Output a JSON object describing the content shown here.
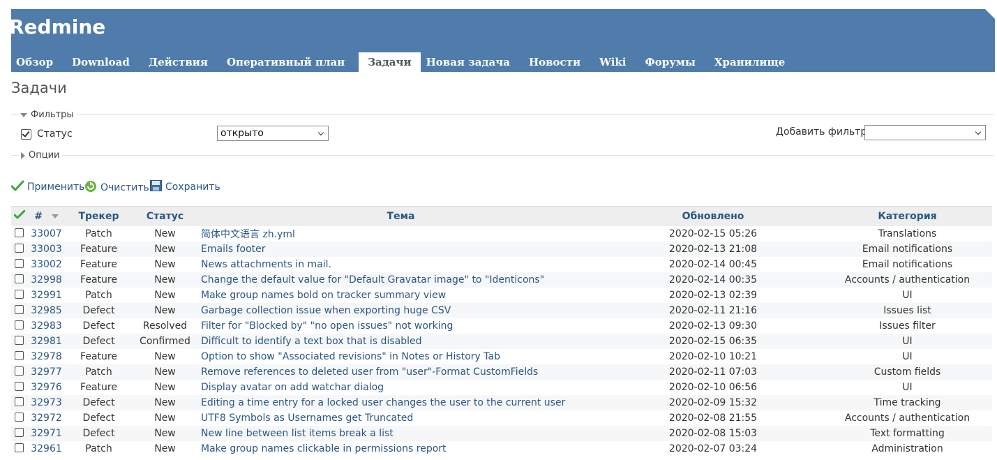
{
  "header": {
    "app_title": "Redmine",
    "menu": [
      {
        "label": "Обзор",
        "selected": false
      },
      {
        "label": "Download",
        "selected": false
      },
      {
        "label": "Действия",
        "selected": false
      },
      {
        "label": "Оперативный план",
        "selected": false
      },
      {
        "label": "Задачи",
        "selected": true
      },
      {
        "label": "Новая задача",
        "selected": false
      },
      {
        "label": "Новости",
        "selected": false
      },
      {
        "label": "Wiki",
        "selected": false
      },
      {
        "label": "Форумы",
        "selected": false
      },
      {
        "label": "Хранилище",
        "selected": false
      }
    ]
  },
  "page_title": "Задачи",
  "filters": {
    "legend": "Фильтры",
    "status_label": "Статус",
    "status_checked": true,
    "status_operator": "открыто",
    "add_filter_label": "Добавить фильтр",
    "add_filter_value": ""
  },
  "options": {
    "legend": "Опции"
  },
  "actions": {
    "apply": "Применить",
    "clear": "Очистить",
    "save": "Сохранить"
  },
  "table": {
    "headers": {
      "id": "#",
      "tracker": "Трекер",
      "status": "Статус",
      "subject": "Тема",
      "updated": "Обновлено",
      "category": "Категория"
    },
    "rows": [
      {
        "id": "33007",
        "tracker": "Patch",
        "status": "New",
        "subject": "简体中文语言 zh.yml",
        "updated": "2020-02-15 05:26",
        "category": "Translations"
      },
      {
        "id": "33003",
        "tracker": "Feature",
        "status": "New",
        "subject": "Emails footer",
        "updated": "2020-02-13 21:08",
        "category": "Email notifications"
      },
      {
        "id": "33002",
        "tracker": "Feature",
        "status": "New",
        "subject": "News attachments in mail.",
        "updated": "2020-02-14 00:45",
        "category": "Email notifications"
      },
      {
        "id": "32998",
        "tracker": "Feature",
        "status": "New",
        "subject": "Change the default value for \"Default Gravatar image\" to \"Identicons\"",
        "updated": "2020-02-14 00:35",
        "category": "Accounts / authentication"
      },
      {
        "id": "32991",
        "tracker": "Patch",
        "status": "New",
        "subject": "Make group names bold on tracker summary view",
        "updated": "2020-02-13 02:39",
        "category": "UI"
      },
      {
        "id": "32985",
        "tracker": "Defect",
        "status": "New",
        "subject": "Garbage collection issue when exporting huge CSV",
        "updated": "2020-02-11 21:16",
        "category": "Issues list"
      },
      {
        "id": "32983",
        "tracker": "Defect",
        "status": "Resolved",
        "subject": "Filter for \"Blocked by\" \"no open issues\" not working",
        "updated": "2020-02-13 09:30",
        "category": "Issues filter"
      },
      {
        "id": "32981",
        "tracker": "Defect",
        "status": "Confirmed",
        "subject": "Difficult to identify a text box that is disabled",
        "updated": "2020-02-15 06:35",
        "category": "UI"
      },
      {
        "id": "32978",
        "tracker": "Feature",
        "status": "New",
        "subject": "Option to show \"Associated revisions\" in Notes or History Tab",
        "updated": "2020-02-10 10:21",
        "category": "UI"
      },
      {
        "id": "32977",
        "tracker": "Patch",
        "status": "New",
        "subject": "Remove references to deleted user from \"user\"-Format CustomFields",
        "updated": "2020-02-11 07:03",
        "category": "Custom fields"
      },
      {
        "id": "32976",
        "tracker": "Feature",
        "status": "New",
        "subject": "Display avatar on add watchar dialog",
        "updated": "2020-02-10 06:56",
        "category": "UI"
      },
      {
        "id": "32973",
        "tracker": "Defect",
        "status": "New",
        "subject": "Editing a time entry for a locked user changes the user to the current user",
        "updated": "2020-02-09 15:32",
        "category": "Time tracking"
      },
      {
        "id": "32972",
        "tracker": "Defect",
        "status": "New",
        "subject": "UTF8 Symbols as Usernames get Truncated",
        "updated": "2020-02-08 21:55",
        "category": "Accounts / authentication"
      },
      {
        "id": "32971",
        "tracker": "Defect",
        "status": "New",
        "subject": "New line between list items break a list",
        "updated": "2020-02-08 15:03",
        "category": "Text formatting"
      },
      {
        "id": "32961",
        "tracker": "Patch",
        "status": "New",
        "subject": "Make group names clickable in permissions report",
        "updated": "2020-02-07 03:24",
        "category": "Administration"
      }
    ]
  },
  "colors": {
    "header_bg": "#4f7caa",
    "link": "#2a5685",
    "row_alt": "#f6f7f8",
    "table_header_bg": "#eeeeee"
  }
}
